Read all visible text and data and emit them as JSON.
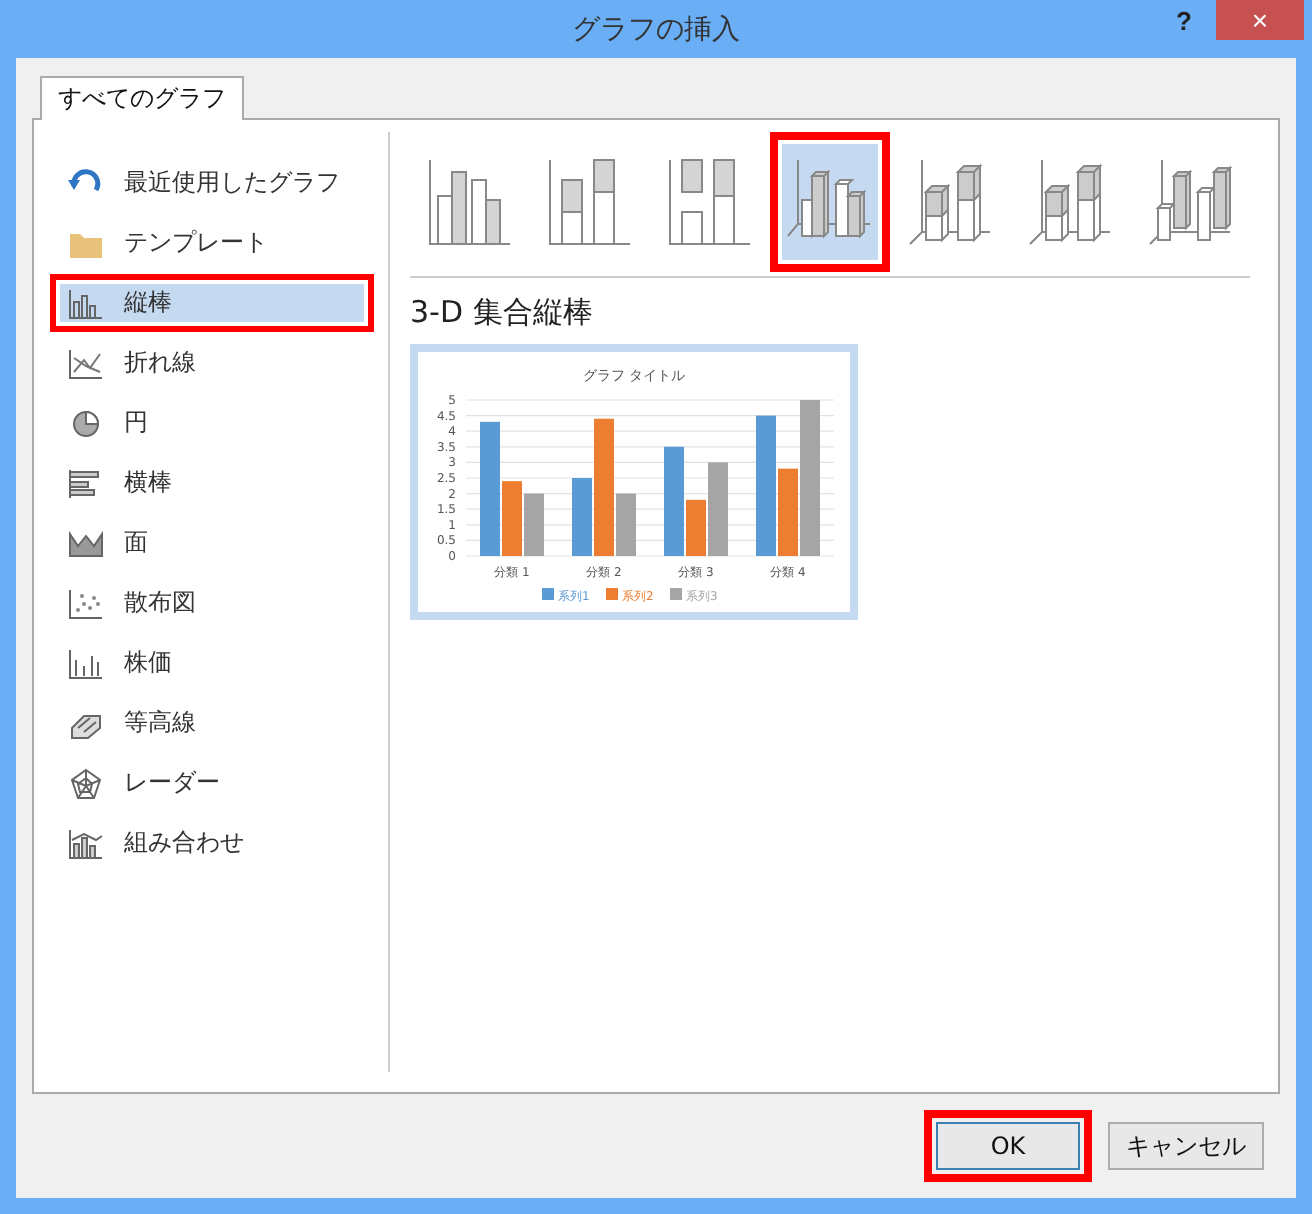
{
  "window": {
    "title": "グラフの挿入",
    "help": "?",
    "close": "×"
  },
  "tabs": [
    {
      "label": "すべてのグラフ",
      "selected": true
    }
  ],
  "sidebar": {
    "items": [
      {
        "label": "最近使用したグラフ",
        "selected": false,
        "highlighted": false
      },
      {
        "label": "テンプレート",
        "selected": false,
        "highlighted": false
      },
      {
        "label": "縦棒",
        "selected": true,
        "highlighted": true
      },
      {
        "label": "折れ線",
        "selected": false,
        "highlighted": false
      },
      {
        "label": "円",
        "selected": false,
        "highlighted": false
      },
      {
        "label": "横棒",
        "selected": false,
        "highlighted": false
      },
      {
        "label": "面",
        "selected": false,
        "highlighted": false
      },
      {
        "label": "散布図",
        "selected": false,
        "highlighted": false
      },
      {
        "label": "株価",
        "selected": false,
        "highlighted": false
      },
      {
        "label": "等高線",
        "selected": false,
        "highlighted": false
      },
      {
        "label": "レーダー",
        "selected": false,
        "highlighted": false
      },
      {
        "label": "組み合わせ",
        "selected": false,
        "highlighted": false
      }
    ]
  },
  "subtypes": [
    {
      "kind": "clustered",
      "selected": false,
      "highlighted": false
    },
    {
      "kind": "stacked",
      "selected": false,
      "highlighted": false
    },
    {
      "kind": "stacked100",
      "selected": false,
      "highlighted": false
    },
    {
      "kind": "clustered3d",
      "selected": true,
      "highlighted": true
    },
    {
      "kind": "stacked3d",
      "selected": false,
      "highlighted": false
    },
    {
      "kind": "stacked100_3d",
      "selected": false,
      "highlighted": false
    },
    {
      "kind": "column3d",
      "selected": false,
      "highlighted": false
    }
  ],
  "subtype_title": "3-D 集合縦棒",
  "preview": {
    "chart_data": {
      "type": "bar",
      "title": "グラフ タイトル",
      "categories": [
        "分類 1",
        "分類 2",
        "分類 3",
        "分類 4"
      ],
      "series": [
        {
          "name": "系列1",
          "color": "#5b9bd5",
          "values": [
            4.3,
            2.5,
            3.5,
            4.5
          ]
        },
        {
          "name": "系列2",
          "color": "#ed7d31",
          "values": [
            2.4,
            4.4,
            1.8,
            2.8
          ]
        },
        {
          "name": "系列3",
          "color": "#a5a5a5",
          "values": [
            2,
            2,
            3,
            5
          ]
        }
      ],
      "grid": true,
      "legend": "bottom",
      "ylim": [
        0,
        5
      ],
      "yticks": [
        0,
        0.5,
        1,
        1.5,
        2,
        2.5,
        3,
        3.5,
        4,
        4.5,
        5
      ]
    }
  },
  "buttons": [
    {
      "label": "OK",
      "kind": "primary",
      "highlighted": true
    },
    {
      "label": "キャンセル",
      "kind": "normal",
      "highlighted": false
    }
  ]
}
